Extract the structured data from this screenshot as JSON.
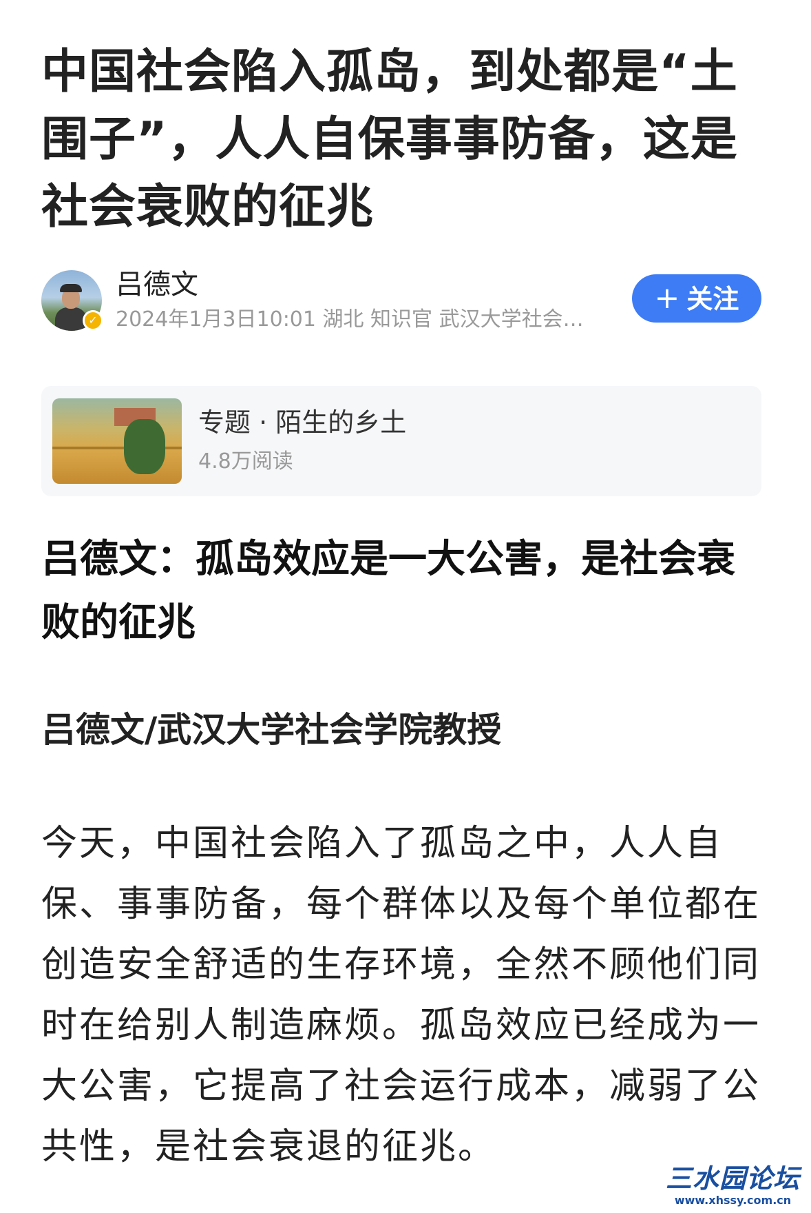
{
  "article": {
    "title": "中国社会陷入孤岛，到处都是“土围子”，人人自保事事防备，这是社会衰败的征兆"
  },
  "author": {
    "name": "吕德文",
    "meta": "2024年1月3日10:01 湖北 知识官 武汉大学社会…",
    "verified_icon": "verified-check-icon",
    "follow_label": "关注",
    "follow_icon": "plus-icon",
    "follow_color": "#3d7cf5"
  },
  "topic": {
    "title": "专题 · 陌生的乡土",
    "reads": "4.8万阅读"
  },
  "content": {
    "subheading": "吕德文：孤岛效应是一大公害，是社会衰败的征兆",
    "byline": "吕德文/武汉大学社会学院教授",
    "paragraph": "今天，中国社会陷入了孤岛之中，人人自保、事事防备，每个群体以及每个单位都在创造安全舒适的生存环境，全然不顾他们同时在给别人制造麻烦。孤岛效应已经成为一大公害，它提高了社会运行成本，减弱了公共性，是社会衰退的征兆。"
  },
  "watermark": {
    "logo": "三水园论坛",
    "url": "www.xhssy.com.cn"
  }
}
